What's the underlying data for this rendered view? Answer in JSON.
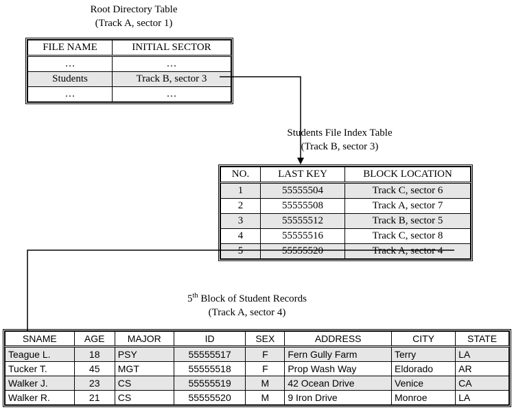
{
  "root": {
    "title_line1": "Root Directory Table",
    "title_line2": "(Track A, sector 1)",
    "headers": [
      "FILE NAME",
      "INITIAL SECTOR"
    ],
    "rows": [
      {
        "file": "…",
        "sector": "…",
        "shade": false
      },
      {
        "file": "Students",
        "sector": "Track B, sector 3",
        "shade": true
      },
      {
        "file": "…",
        "sector": "…",
        "shade": false
      }
    ]
  },
  "index": {
    "title_line1": "Students File Index Table",
    "title_line2": "(Track B, sector 3)",
    "headers": [
      "NO.",
      "LAST KEY",
      "BLOCK LOCATION"
    ],
    "rows": [
      {
        "no": "1",
        "key": "55555504",
        "loc": "Track C, sector 6",
        "shade": true
      },
      {
        "no": "2",
        "key": "55555508",
        "loc": "Track A, sector 7",
        "shade": false
      },
      {
        "no": "3",
        "key": "55555512",
        "loc": "Track B, sector 5",
        "shade": true
      },
      {
        "no": "4",
        "key": "55555516",
        "loc": "Track C, sector 8",
        "shade": false
      },
      {
        "no": "5",
        "key": "55555520",
        "loc": "Track A, sector 4",
        "shade": true
      }
    ]
  },
  "records": {
    "title_prefix": "5",
    "title_sup": "th",
    "title_suffix": " Block of Student Records",
    "title_line2": "(Track A, sector 4)",
    "headers": [
      "SNAME",
      "AGE",
      "MAJOR",
      "ID",
      "SEX",
      "ADDRESS",
      "CITY",
      "STATE"
    ],
    "rows": [
      {
        "sname": "Teague L.",
        "age": "18",
        "major": "PSY",
        "id": "55555517",
        "sex": "F",
        "addr": "Fern Gully Farm",
        "city": "Terry",
        "state": "LA",
        "shade": true
      },
      {
        "sname": "Tucker T.",
        "age": "45",
        "major": "MGT",
        "id": "55555518",
        "sex": "F",
        "addr": "Prop Wash Way",
        "city": "Eldorado",
        "state": "AR",
        "shade": false
      },
      {
        "sname": "Walker J.",
        "age": "23",
        "major": "CS",
        "id": "55555519",
        "sex": "M",
        "addr": "42 Ocean Drive",
        "city": "Venice",
        "state": "CA",
        "shade": true
      },
      {
        "sname": "Walker R.",
        "age": "21",
        "major": "CS",
        "id": "55555520",
        "sex": "M",
        "addr": "9 Iron Drive",
        "city": "Monroe",
        "state": "LA",
        "shade": false
      }
    ]
  }
}
